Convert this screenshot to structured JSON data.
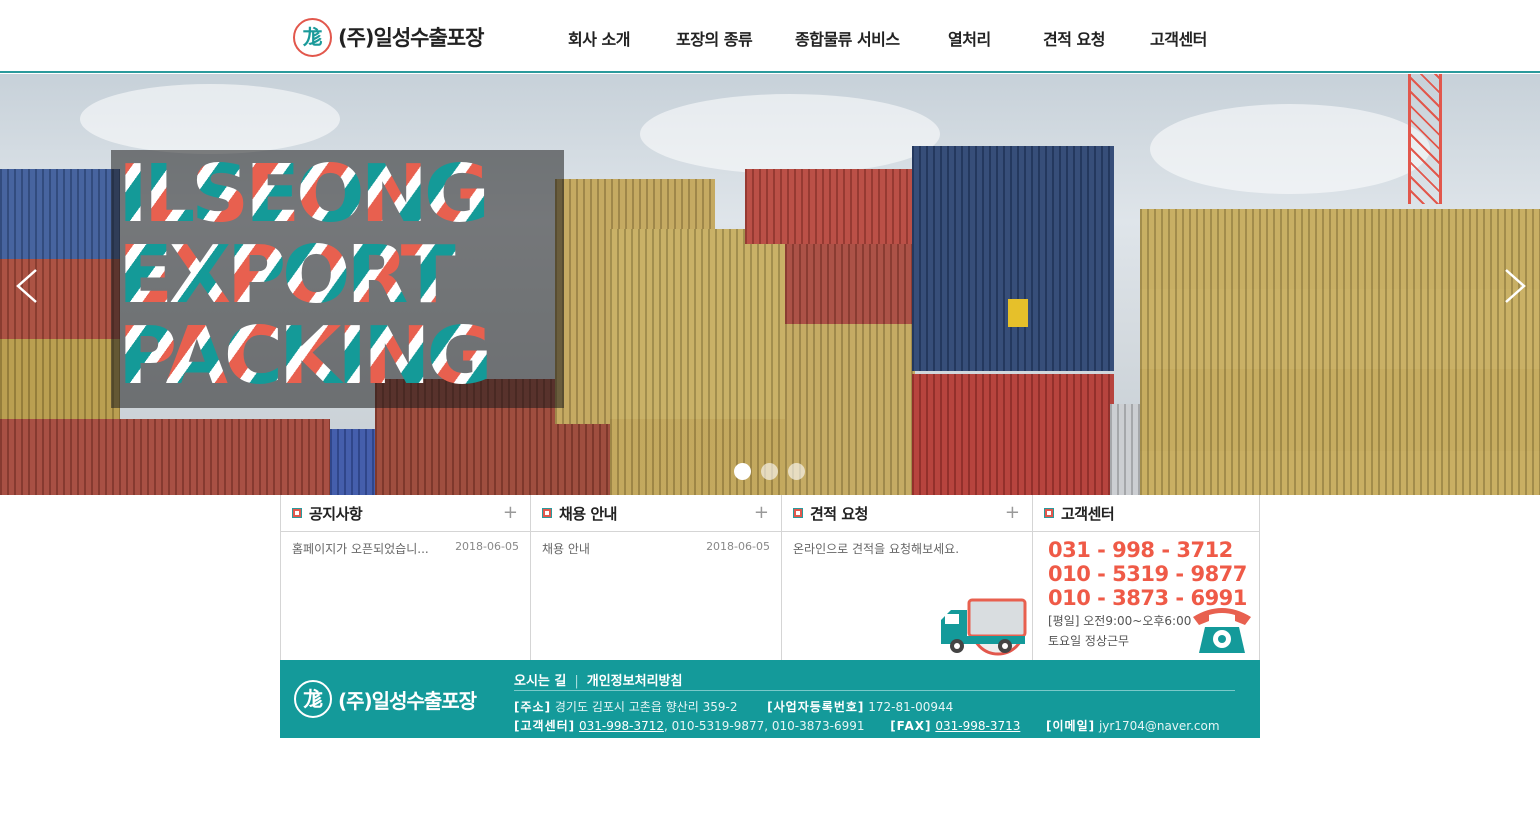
{
  "header": {
    "logo_text": "(주)일성수출포장",
    "logo_glyph": "尨",
    "nav": [
      "회사 소개",
      "포장의 종류",
      "종합물류 서비스",
      "열처리",
      "견적 요청",
      "고객센터"
    ]
  },
  "hero": {
    "title_lines": [
      "ILSEONG",
      "EXPORT",
      "PACKING"
    ],
    "prev_label": "<",
    "next_label": ">",
    "dot_count": 3,
    "active_dot": 0
  },
  "panels": {
    "notice": {
      "title": "공지사항",
      "plus": "+",
      "item": "홈페이지가 오픈되었습니...",
      "date": "2018-06-05"
    },
    "recruit": {
      "title": "채용 안내",
      "plus": "+",
      "item": "채용 안내",
      "date": "2018-06-05"
    },
    "quote": {
      "title": "견적 요청",
      "plus": "+",
      "item": "온라인으로 견적을 요청해보세요."
    },
    "center": {
      "title": "고객센터",
      "phones": [
        "031 - 998 - 3712",
        "010 - 5319 - 9877",
        "010 - 3873 - 6991"
      ],
      "hours": "[평일] 오전9:00~오후6:00",
      "saturday": "토요일 정상근무"
    }
  },
  "footer": {
    "logo_text": "(주)일성수출포장",
    "link_location": "오시는 길",
    "link_separator": "|",
    "link_privacy": "개인정보처리방침",
    "addr_label": "[주소]",
    "addr_value": "경기도 김포시 고촌읍 향산리 359-2",
    "biz_label": "[사업자등록번호]",
    "biz_value": "172-81-00944",
    "cs_label": "[고객센터]",
    "cs_phone1": "031-998-3712",
    "cs_phone_rest": ", 010-5319-9877, 010-3873-6991",
    "fax_label": "[FAX]",
    "fax_value": "031-998-3713",
    "email_label": "[이메일]",
    "email_value": "jyr1704@naver.com"
  },
  "colors": {
    "teal": "#149a9a",
    "coral": "#ef5a47"
  }
}
